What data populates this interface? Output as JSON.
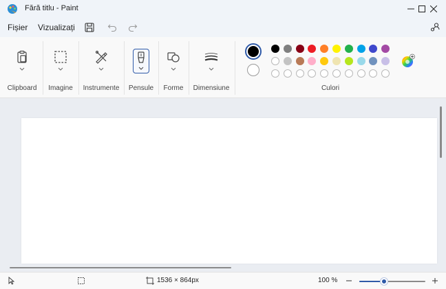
{
  "window": {
    "title": "Fără titlu - Paint",
    "app_icon": "paint-palette-icon"
  },
  "menu": {
    "file_label": "Fișier",
    "view_label": "Vizualizați",
    "icons": [
      "save-icon",
      "undo-icon",
      "redo-icon",
      "account-settings-icon"
    ]
  },
  "ribbon": {
    "groups": [
      {
        "label": "Clipboard",
        "icon": "clipboard-icon"
      },
      {
        "label": "Imagine",
        "icon": "selection-icon"
      },
      {
        "label": "Instrumente",
        "icon": "tools-icon"
      },
      {
        "label": "Pensule",
        "icon": "brush-icon",
        "selected": true
      },
      {
        "label": "Forme",
        "icon": "shapes-icon"
      },
      {
        "label": "Dimensiune",
        "icon": "stroke-size-icon"
      }
    ],
    "colors_label": "Culori",
    "primary_color": "#000000",
    "secondary_color": "#ffffff",
    "palette_row1": [
      "#000000",
      "#7f7f7f",
      "#880015",
      "#ed1c24",
      "#ff7f27",
      "#fff200",
      "#22b14c",
      "#00a2e8",
      "#3f48cc",
      "#a349a4"
    ],
    "palette_row2": [
      "#ffffff",
      "#c3c3c3",
      "#b97a57",
      "#ffaec9",
      "#ffc90e",
      "#efe4b0",
      "#b5e61d",
      "#99d9ea",
      "#7092be",
      "#c8bfe7"
    ],
    "palette_row3_count": 10,
    "edit_colors_icon": "color-wheel-icon"
  },
  "status": {
    "pointer_icon": "cursor-icon",
    "selection_icon": "selection-size-icon",
    "canvas_size_icon": "canvas-size-icon",
    "canvas_size": "1536 × 864px",
    "zoom": "100 %",
    "zoom_level": 0.38,
    "zoom_out_icon": "zoom-out-icon",
    "zoom_in_icon": "zoom-in-icon"
  }
}
